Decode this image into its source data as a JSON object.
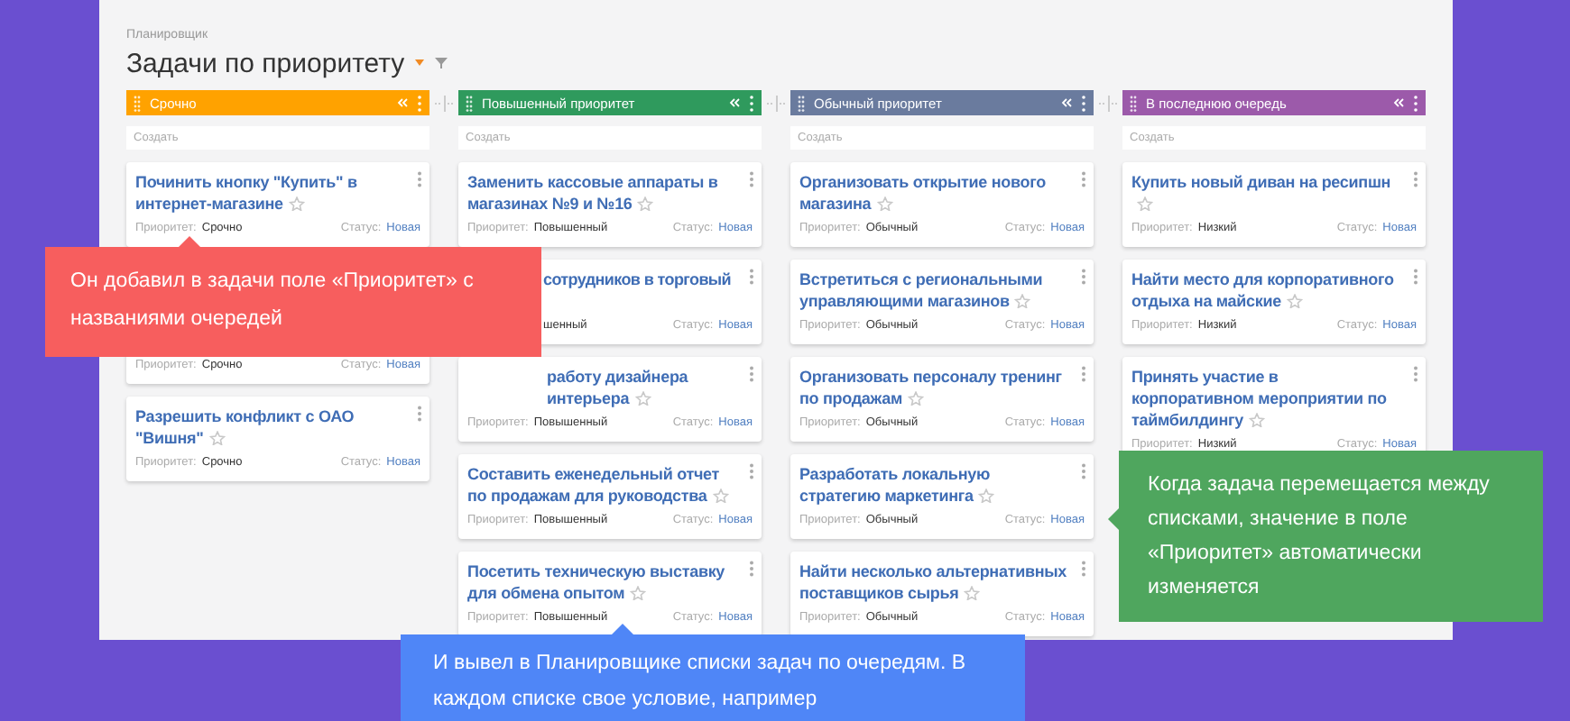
{
  "header": {
    "section": "Планировщик",
    "title": "Задачи по приоритету"
  },
  "columns": [
    {
      "title": "Срочно",
      "color": "#ffa200",
      "placeholder": "Создать",
      "cards": [
        {
          "kind": "full",
          "title": "Починить кнопку \"Купить\" в интернет-магазине",
          "priority_label": "Приоритет:",
          "priority": "Срочно",
          "status_label": "Статус:",
          "status": "Новая"
        },
        {
          "kind": "hidden",
          "priority_label": "Приоритет:",
          "priority": "Срочно",
          "status_label": "Статус:",
          "status": "Новая"
        },
        {
          "kind": "full",
          "title": "Разрешить конфликт с ОАО \"Вишня\"",
          "priority_label": "Приоритет:",
          "priority": "Срочно",
          "status_label": "Статус:",
          "status": "Новая"
        }
      ]
    },
    {
      "title": "Повышенный приоритет",
      "color": "#2f9a5d",
      "placeholder": "Создать",
      "cards": [
        {
          "kind": "full",
          "title": "Заменить кассовые аппараты в магазинах №9 и №16",
          "priority_label": "Приоритет:",
          "priority": "Повышенный",
          "status_label": "Статус:",
          "status": "Новая"
        },
        {
          "kind": "cut",
          "title": "сотрудников в торговый",
          "priority": "шенный",
          "status_label": "Статус:",
          "status": "Новая"
        },
        {
          "kind": "tail",
          "title": "работу дизайнера интерьера",
          "priority_label": "Приоритет:",
          "priority": "Повышенный",
          "status_label": "Статус:",
          "status": "Новая"
        },
        {
          "kind": "full",
          "title": "Составить еженедельный отчет по продажам для руководства",
          "priority_label": "Приоритет:",
          "priority": "Повышенный",
          "status_label": "Статус:",
          "status": "Новая"
        },
        {
          "kind": "full",
          "title": "Посетить техническую выставку для обмена опытом",
          "priority_label": "Приоритет:",
          "priority": "Повышенный",
          "status_label": "Статус:",
          "status": "Новая"
        }
      ]
    },
    {
      "title": "Обычный приоритет",
      "color": "#6a7b9e",
      "placeholder": "Создать",
      "cards": [
        {
          "kind": "full",
          "title": "Организовать открытие нового магазина",
          "priority_label": "Приоритет:",
          "priority": "Обычный",
          "status_label": "Статус:",
          "status": "Новая"
        },
        {
          "kind": "full",
          "title": "Встретиться с региональными управляющими магазинов",
          "priority_label": "Приоритет:",
          "priority": "Обычный",
          "status_label": "Статус:",
          "status": "Новая"
        },
        {
          "kind": "full",
          "title": "Организовать персоналу тренинг по продажам",
          "priority_label": "Приоритет:",
          "priority": "Обычный",
          "status_label": "Статус:",
          "status": "Новая"
        },
        {
          "kind": "full",
          "title": "Разработать локальную стратегию маркетинга",
          "priority_label": "Приоритет:",
          "priority": "Обычный",
          "status_label": "Статус:",
          "status": "Новая"
        },
        {
          "kind": "full",
          "title": "Найти несколько альтернативных поставщиков сырья",
          "priority_label": "Приоритет:",
          "priority": "Обычный",
          "status_label": "Статус:",
          "status": "Новая"
        }
      ]
    },
    {
      "title": "В последнюю очередь",
      "color": "#9c5aaa",
      "placeholder": "Создать",
      "cards": [
        {
          "kind": "full",
          "title": "Купить новый диван на ресипшн",
          "priority_label": "Приоритет:",
          "priority": "Низкий",
          "status_label": "Статус:",
          "status": "Новая"
        },
        {
          "kind": "full",
          "title": "Найти место для корпоративного отдыха на майские",
          "priority_label": "Приоритет:",
          "priority": "Низкий",
          "status_label": "Статус:",
          "status": "Новая"
        },
        {
          "kind": "full",
          "title": "Принять участие в корпоративном мероприятии по таймбилдингу",
          "priority_label": "Приоритет:",
          "priority": "Низкий",
          "status_label": "Статус:",
          "status": "Новая"
        }
      ]
    }
  ],
  "callouts": [
    {
      "kind": "top",
      "color": "#f75e5e",
      "text": "Он добавил в задачи поле «Приоритет» с названиями очередей"
    },
    {
      "kind": "left",
      "color": "#4fa65e",
      "text": "Когда задача перемещается между списками, значение в поле «Приоритет» автоматически изменяется"
    },
    {
      "kind": "bottom",
      "color": "#4f86f7",
      "text": "И вывел в Планировщике списки задач по очередям. В каждом списке свое условие, например"
    }
  ]
}
